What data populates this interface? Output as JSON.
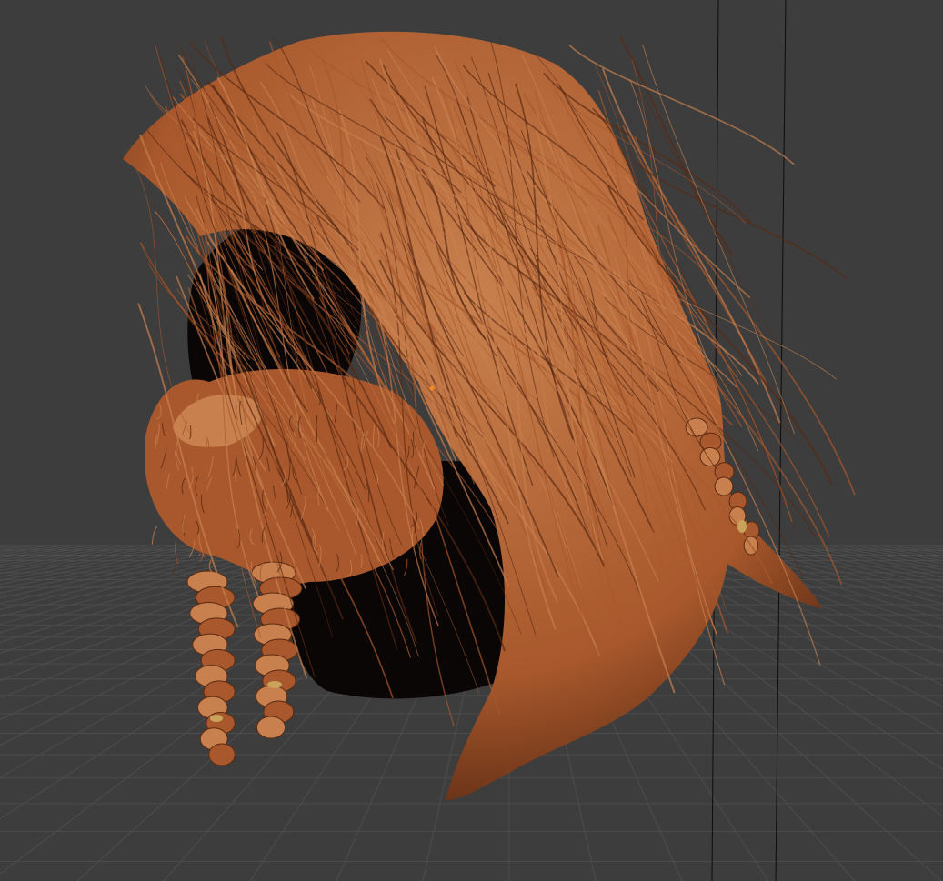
{
  "viewport": {
    "background_color": "#3d3d3d",
    "grid_color": "#4d4d4d",
    "guide_line_color": "#0d0d0d",
    "object_origin_color": "#f08a24"
  },
  "model": {
    "hair_color": "#a8582c",
    "hair_highlight": "#c8804e",
    "hair_shadow": "#5a2a12",
    "head_base_color": "#0a0605",
    "bead_color": "#c9a35a",
    "icon": "object-origin-icon"
  }
}
